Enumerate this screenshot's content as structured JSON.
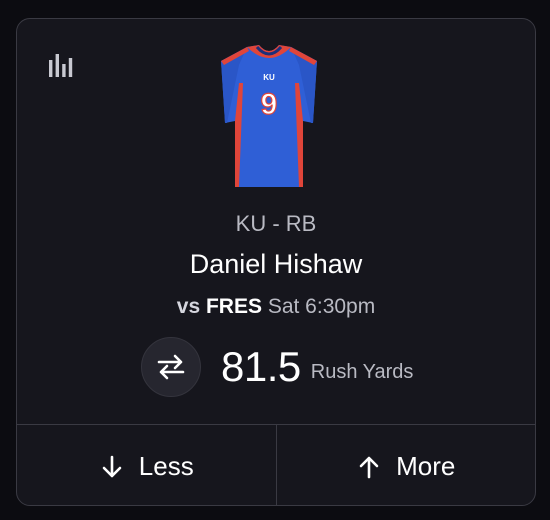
{
  "player": {
    "team_position": "KU - RB",
    "name": "Daniel Hishaw",
    "jersey_number": "9",
    "jersey_team": "KU"
  },
  "matchup": {
    "vs": "vs",
    "opponent": "FRES",
    "time": "Sat 6:30pm"
  },
  "projection": {
    "value": "81.5",
    "stat": "Rush Yards"
  },
  "actions": {
    "less_label": "Less",
    "more_label": "More"
  },
  "icons": {
    "stats": "bar-chart-icon",
    "swap": "swap-arrows-icon",
    "less": "arrow-down-icon",
    "more": "arrow-up-icon"
  },
  "colors": {
    "jersey_blue": "#2f5fd6",
    "jersey_red": "#e0453a",
    "card_bg": "#16161d",
    "border": "#3a3a43"
  }
}
